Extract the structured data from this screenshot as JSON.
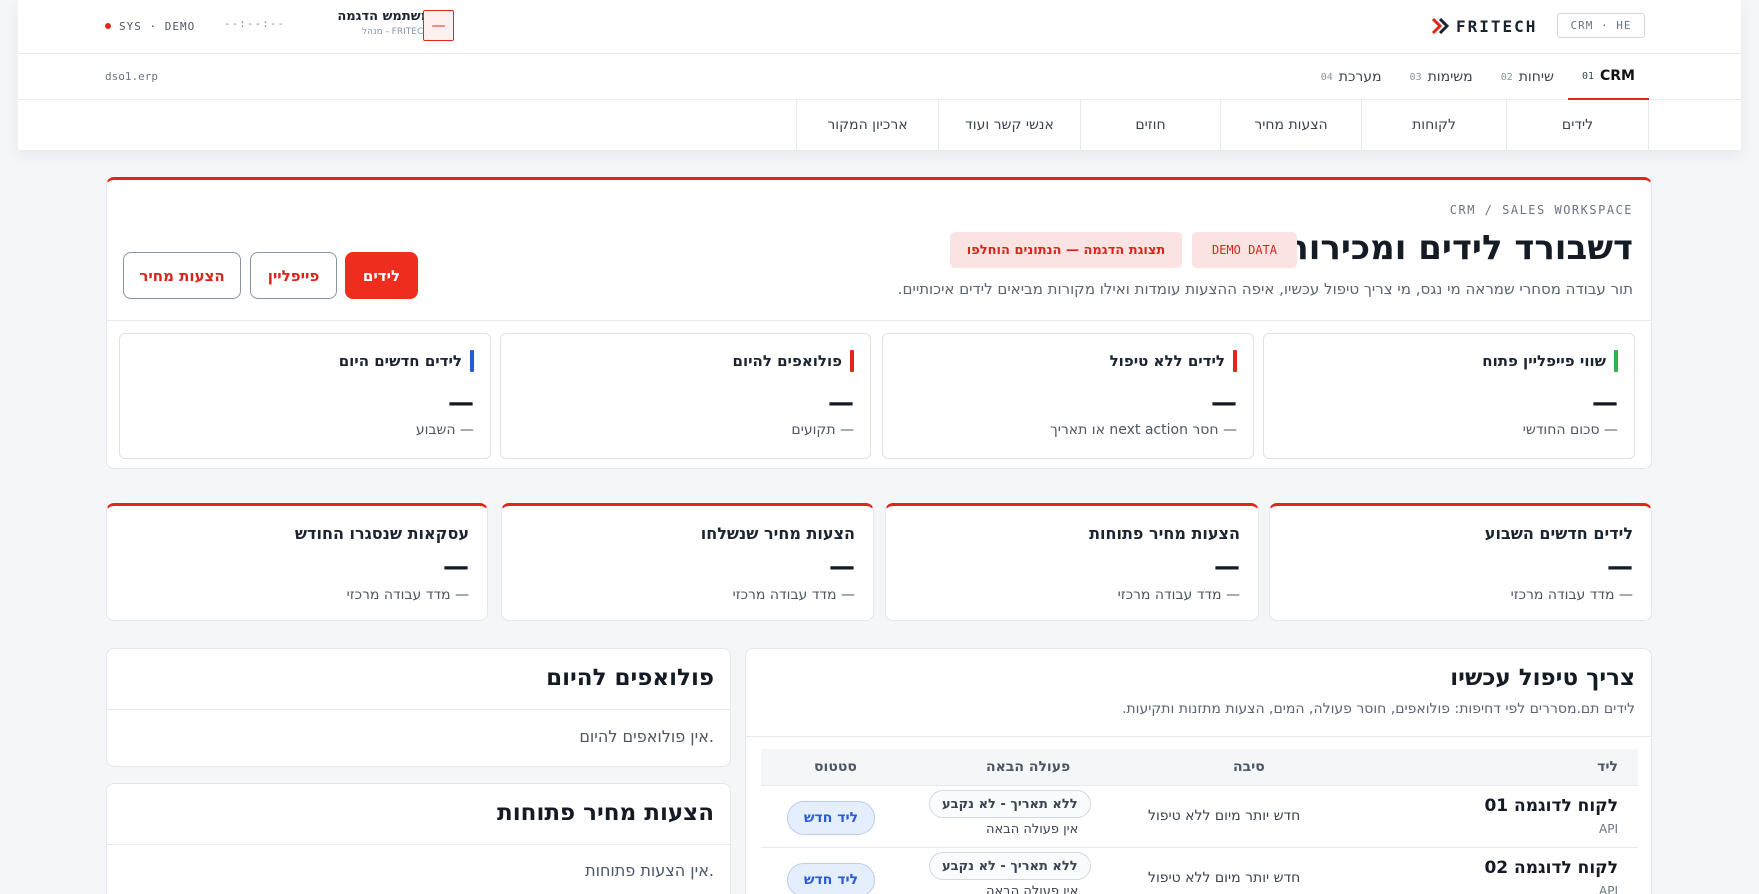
{
  "header": {
    "lang_badge": "CRM · HE",
    "brand": "FRITECH",
    "sys_status": "SYS · DEMO",
    "clock": "--:--:--",
    "user_name": "משתמש הדגמה",
    "user_role": "מנהל - FRITECH",
    "user_button": "—",
    "host": "dso1.erp",
    "accent_color": "#e2261c"
  },
  "modules": [
    {
      "num": "01",
      "label": "CRM"
    },
    {
      "num": "02",
      "label": "שיחות"
    },
    {
      "num": "03",
      "label": "משימות"
    },
    {
      "num": "04",
      "label": "מערכת"
    }
  ],
  "subnav": [
    "לידים",
    "לקוחות",
    "הצעות מחיר",
    "חוזים",
    "אנשי קשר ועוד",
    "ארכיון המקור"
  ],
  "hero": {
    "breadcrumb": "CRM / SALES WORKSPACE",
    "title": "דשבורד לידים ומכירות",
    "demo_badge": "DEMO DATA",
    "demo_note": "תצוגת הדגמה — הנתונים הוחלפו",
    "subtitle": "תור עבודה מסחרי שמראה מי נגס, מי צריך טיפול עכשיו, איפה ההצעות עומדות ואילו מקורות מביאים לידים איכותיים.",
    "btn_leads": "לידים",
    "btn_pipeline": "פייפליין",
    "btn_quotes": "הצעות מחיר"
  },
  "kpis": [
    {
      "title": "שווי פייפליין פתוח",
      "value": "—",
      "sub": "—  סכום החודשי",
      "color": "#2bb24c"
    },
    {
      "title": "לידים ללא טיפול",
      "value": "—",
      "sub": "—  חסר next action או תאריך",
      "color": "#e2261c"
    },
    {
      "title": "פולואפים להיום",
      "value": "—",
      "sub": "—  תקועים",
      "color": "#e2261c"
    },
    {
      "title": "לידים חדשים היום",
      "value": "—",
      "sub": "—  השבוע",
      "color": "#2a5bd7"
    }
  ],
  "stats": [
    {
      "title": "לידים חדשים השבוע",
      "value": "—",
      "sub": "—  מדד עבודה מרכזי"
    },
    {
      "title": "הצעות מחיר פתוחות",
      "value": "—",
      "sub": "—  מדד עבודה מרכזי"
    },
    {
      "title": "הצעות מחיר שנשלחו",
      "value": "—",
      "sub": "—  מדד עבודה מרכזי"
    },
    {
      "title": "עסקאות שנסגרו החודש",
      "value": "—",
      "sub": "—  מדד עבודה מרכזי"
    }
  ],
  "attention": {
    "title": "צריך טיפול עכשיו",
    "subtitle": "לידים תם.מסררים לפי דחיפות: פולואפים, חוסר פעולה, המים, הצעות מתזנות ותקיעות.",
    "columns": {
      "lead": "ליד",
      "reason": "סיבה",
      "next": "פעולה הבאה",
      "status": "סטטוס"
    },
    "rows": [
      {
        "name": "לקוח לדוגמה 01",
        "source": "API",
        "reason": "חדש יותר מיום ללא טיפול",
        "next_pill": "ללא תאריך - לא נקבע",
        "next_sub": "אין פעולה הבאה",
        "status": "ליד חדש"
      },
      {
        "name": "לקוח לדוגמה 02",
        "source": "API",
        "reason": "חדש יותר מיום ללא טיפול",
        "next_pill": "ללא תאריך - לא נקבע",
        "next_sub": "אין פעולה הבאה",
        "status": "ליד חדש"
      }
    ]
  },
  "followups_panel": {
    "title": "פולואפים להיום",
    "empty": "אין פולואפים להיום."
  },
  "quotes_panel": {
    "title": "הצעות מחיר פתוחות",
    "empty": "אין הצעות פתוחות."
  }
}
